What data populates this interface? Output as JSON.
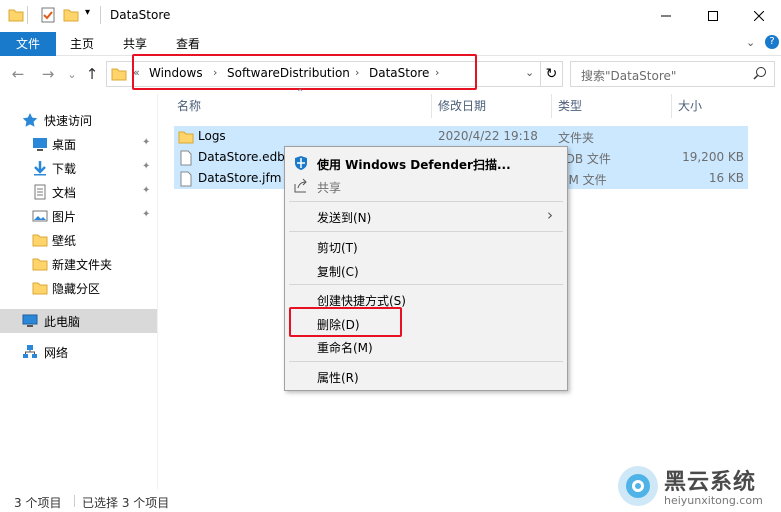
{
  "window": {
    "title": "DataStore",
    "qa_icons": [
      "folder-icon",
      "properties-icon",
      "new-folder-icon",
      "dropdown-icon"
    ],
    "minimize": "—",
    "maximize": "☐",
    "close": "✕",
    "help": "?"
  },
  "ribbon": {
    "tabs": [
      "文件",
      "主页",
      "共享",
      "查看"
    ],
    "expand": "⌄"
  },
  "nav": {
    "back": "←",
    "forward": "→",
    "recent": "⌄",
    "up": "↑"
  },
  "address": {
    "lead": "«",
    "crumbs": [
      "Windows",
      "SoftwareDistribution",
      "DataStore"
    ],
    "sep": "›",
    "refresh": "↻"
  },
  "search": {
    "placeholder": "搜索\"DataStore\""
  },
  "sidebar": {
    "items": [
      {
        "label": "快速访问",
        "icon": "star-icon",
        "pinned": false
      },
      {
        "label": "桌面",
        "icon": "desktop-icon",
        "pinned": true
      },
      {
        "label": "下载",
        "icon": "download-icon",
        "pinned": true
      },
      {
        "label": "文档",
        "icon": "document-icon",
        "pinned": true
      },
      {
        "label": "图片",
        "icon": "pictures-icon",
        "pinned": true
      },
      {
        "label": "壁纸",
        "icon": "folder-icon",
        "pinned": false
      },
      {
        "label": "新建文件夹",
        "icon": "folder-icon",
        "pinned": false
      },
      {
        "label": "隐藏分区",
        "icon": "folder-icon",
        "pinned": false
      },
      {
        "label": "此电脑",
        "icon": "computer-icon",
        "pinned": false
      },
      {
        "label": "网络",
        "icon": "network-icon",
        "pinned": false
      }
    ],
    "pin_glyph": "📌"
  },
  "columns": {
    "name": "名称",
    "date": "修改日期",
    "type": "类型",
    "size": "大小"
  },
  "files": [
    {
      "name": "Logs",
      "date": "2020/4/22 19:18",
      "type": "文件夹",
      "size": "",
      "icon": "folder-icon"
    },
    {
      "name": "DataStore.edb",
      "date": "",
      "type": "EDB 文件",
      "size": "19,200 KB",
      "icon": "file-icon"
    },
    {
      "name": "DataStore.jfm",
      "date": "",
      "type": "JFM 文件",
      "size": "16 KB",
      "icon": "file-icon"
    }
  ],
  "context_menu": {
    "items": [
      {
        "label": "使用 Windows Defender扫描...",
        "bold": true,
        "icon": "defender-icon"
      },
      {
        "label": "共享",
        "icon": "share-icon"
      },
      {
        "label": "发送到(N)",
        "submenu": true
      },
      {
        "label": "剪切(T)"
      },
      {
        "label": "复制(C)"
      },
      {
        "label": "创建快捷方式(S)"
      },
      {
        "label": "删除(D)"
      },
      {
        "label": "重命名(M)"
      },
      {
        "label": "属性(R)"
      }
    ],
    "submenu_arrow": "›"
  },
  "status": {
    "count": "3 个项目",
    "selected": "已选择 3 个项目"
  },
  "watermark": {
    "name": "黑云系统",
    "url": "heiyunxitong.com"
  },
  "colors": {
    "accent": "#1979ca",
    "selection": "#cce8ff",
    "highlight_red": "#e81123",
    "folder": "#ffd46a"
  }
}
